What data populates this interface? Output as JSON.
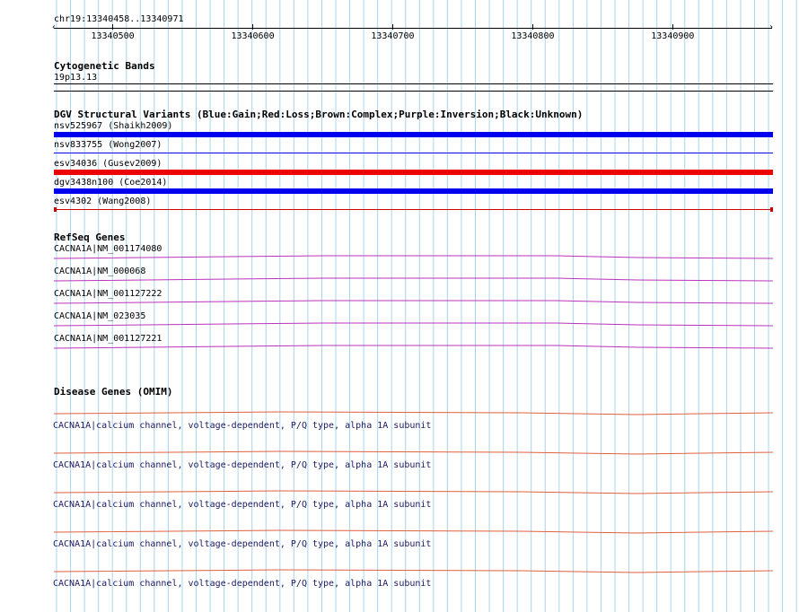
{
  "ruler": {
    "location": "chr19:13340458..13340971",
    "ticks": [
      "13340500",
      "13340600",
      "13340700",
      "13340800",
      "13340900"
    ]
  },
  "cytoband": {
    "title": "Cytogenetic Bands",
    "band": "19p13.13"
  },
  "dgv": {
    "title": "DGV Structural Variants (Blue:Gain;Red:Loss;Brown:Complex;Purple:Inversion;Black:Unknown)",
    "items": [
      {
        "label": "nsv525967 (Shaikh2009)",
        "style": "thick",
        "color": "#0000ee"
      },
      {
        "label": "nsv833755 (Wong2007)",
        "style": "thin",
        "color": "#0000ee"
      },
      {
        "label": "esv34036 (Gusev2009)",
        "style": "thick",
        "color": "#ee0000"
      },
      {
        "label": "dgv3438n100 (Coe2014)",
        "style": "thick",
        "color": "#0000ee"
      },
      {
        "label": "esv4302 (Wang2008)",
        "style": "thin-capped",
        "color": "#cc0000"
      }
    ]
  },
  "refseq": {
    "title": "RefSeq Genes",
    "color": "#bb33bb",
    "items": [
      {
        "label": "CACNA1A|NM_001174080"
      },
      {
        "label": "CACNA1A|NM_000068"
      },
      {
        "label": "CACNA1A|NM_001127222"
      },
      {
        "label": "CACNA1A|NM_023035"
      },
      {
        "label": "CACNA1A|NM_001127221"
      }
    ]
  },
  "omim": {
    "title": "Disease Genes (OMIM)",
    "color": "#e06040",
    "items": [
      {
        "label": "CACNA1A|calcium channel, voltage-dependent, P/Q type, alpha 1A subunit"
      },
      {
        "label": "CACNA1A|calcium channel, voltage-dependent, P/Q type, alpha 1A subunit"
      },
      {
        "label": "CACNA1A|calcium channel, voltage-dependent, P/Q type, alpha 1A subunit"
      },
      {
        "label": "CACNA1A|calcium channel, voltage-dependent, P/Q type, alpha 1A subunit"
      },
      {
        "label": "CACNA1A|calcium channel, voltage-dependent, P/Q type, alpha 1A subunit"
      }
    ]
  },
  "colors": {
    "grid": "#a8d4ec"
  }
}
